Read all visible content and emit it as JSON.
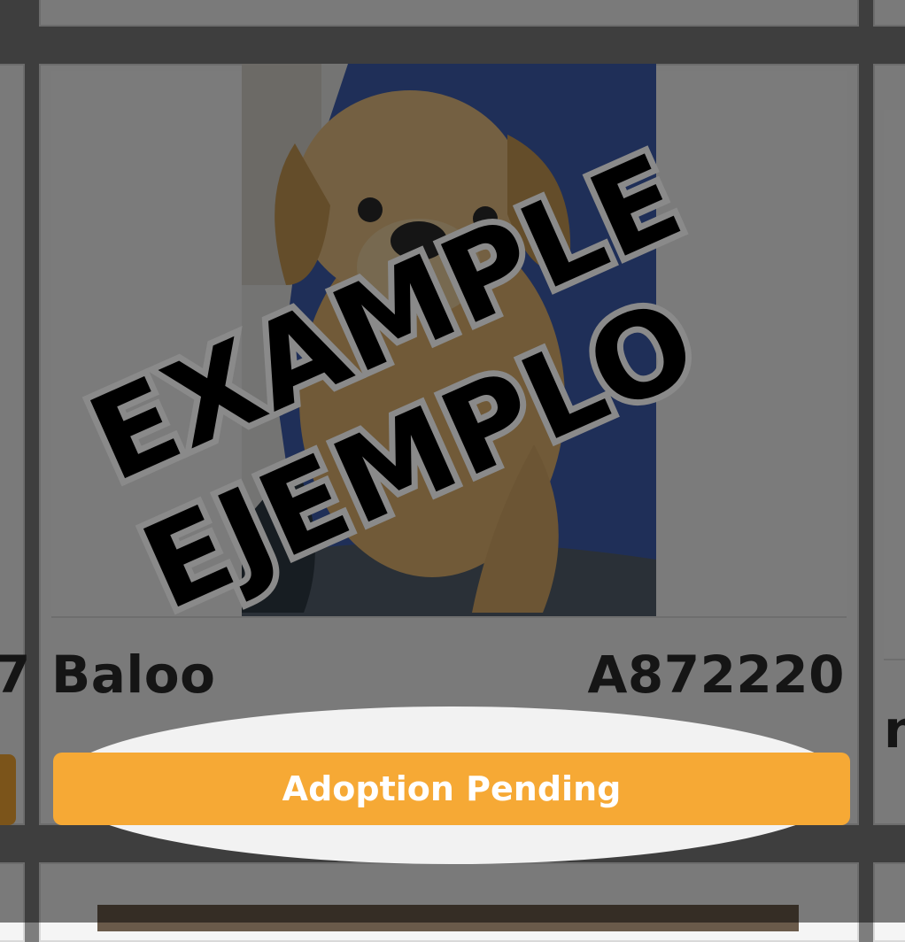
{
  "pet": {
    "name": "Baloo",
    "id": "A872220",
    "status": "Adoption Pending",
    "photo_icon": "dog-photo"
  },
  "watermark": {
    "line1": "EXAMPLE",
    "line2": "EJEMPLO"
  },
  "peeks": {
    "left_text": "7",
    "right_text": "n"
  },
  "colors": {
    "status_orange": "#f6a935",
    "overlay": "rgba(0,0,0,0.5)",
    "text_dark": "#2b2b2b"
  }
}
